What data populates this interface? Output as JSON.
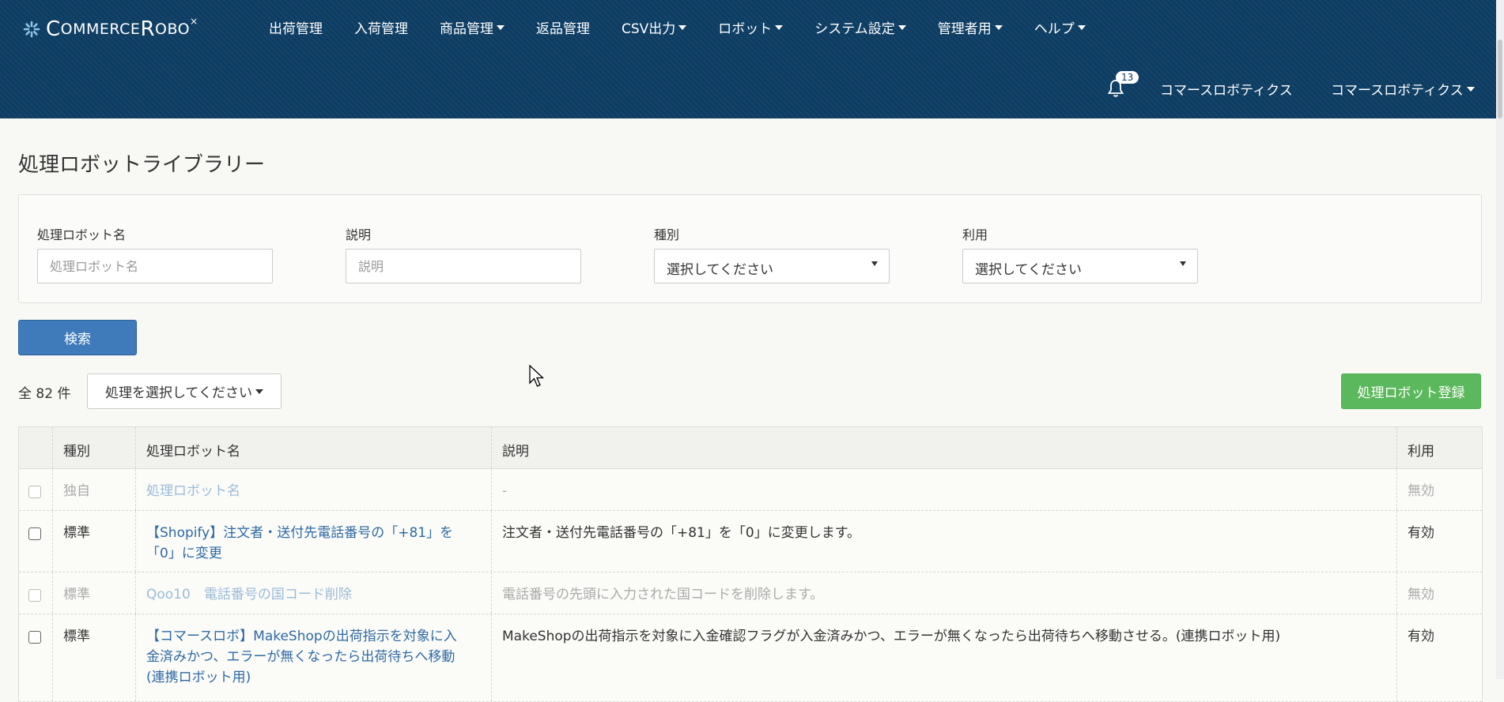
{
  "brand": {
    "name_c": "C",
    "name_rest1": "OMMERCE ",
    "name_r": "R",
    "name_rest2": "OBO",
    "mark": "×"
  },
  "nav": {
    "items": [
      {
        "label": "出荷管理",
        "dropdown": false
      },
      {
        "label": "入荷管理",
        "dropdown": false
      },
      {
        "label": "商品管理",
        "dropdown": true
      },
      {
        "label": "返品管理",
        "dropdown": false
      },
      {
        "label": "CSV出力",
        "dropdown": true
      },
      {
        "label": "ロボット",
        "dropdown": true
      },
      {
        "label": "システム設定",
        "dropdown": true
      },
      {
        "label": "管理者用",
        "dropdown": true
      },
      {
        "label": "ヘルプ",
        "dropdown": true
      }
    ],
    "notification_count": "13",
    "company": "コマースロボティクス",
    "user": "コマースロボティクス",
    "bar_color": "#0e3d63"
  },
  "page": {
    "title": "処理ロボットライブラリー"
  },
  "filters": {
    "name_label": "処理ロボット名",
    "name_placeholder": "処理ロボット名",
    "desc_label": "説明",
    "desc_placeholder": "説明",
    "type_label": "種別",
    "type_value": "選択してください",
    "use_label": "利用",
    "use_value": "選択してください",
    "search_label": "検索"
  },
  "toolbar": {
    "count_prefix": "全",
    "count": "82",
    "count_suffix": "件",
    "bulk_label": "処理を選択してください",
    "register_label": "処理ロボット登録"
  },
  "table": {
    "headers": [
      "種別",
      "処理ロボット名",
      "説明",
      "利用"
    ],
    "rows": [
      {
        "type": "独自",
        "name": "処理ロボット名",
        "description": "-",
        "status": "無効",
        "enabled": false
      },
      {
        "type": "標準",
        "name_l1": "【Shopify】注文者・送付先電話番号の「+81」を",
        "name_l2": "「0」に変更",
        "description": "注文者・送付先電話番号の「+81」を「0」に変更します。",
        "status": "有効",
        "enabled": true
      },
      {
        "type": "標準",
        "name": "Qoo10　電話番号の国コード削除",
        "description": "電話番号の先頭に入力された国コードを削除します。",
        "status": "無効",
        "enabled": false
      },
      {
        "type": "標準",
        "name_l1": "【コマースロボ】MakeShopの出荷指示を対象に入",
        "name_l2": "金済みかつ、エラーが無くなったら出荷待ちへ移動",
        "name_l3": "(連携ロボット用)",
        "description": "MakeShopの出荷指示を対象に入金確認フラグが入金済みかつ、エラーが無くなったら出荷待ちへ移動させる。(連携ロボット用)",
        "status": "有効",
        "enabled": true
      }
    ]
  },
  "colors": {
    "primary": "#3f7bba",
    "success": "#5cb85c",
    "link": "#2f6aa4"
  }
}
